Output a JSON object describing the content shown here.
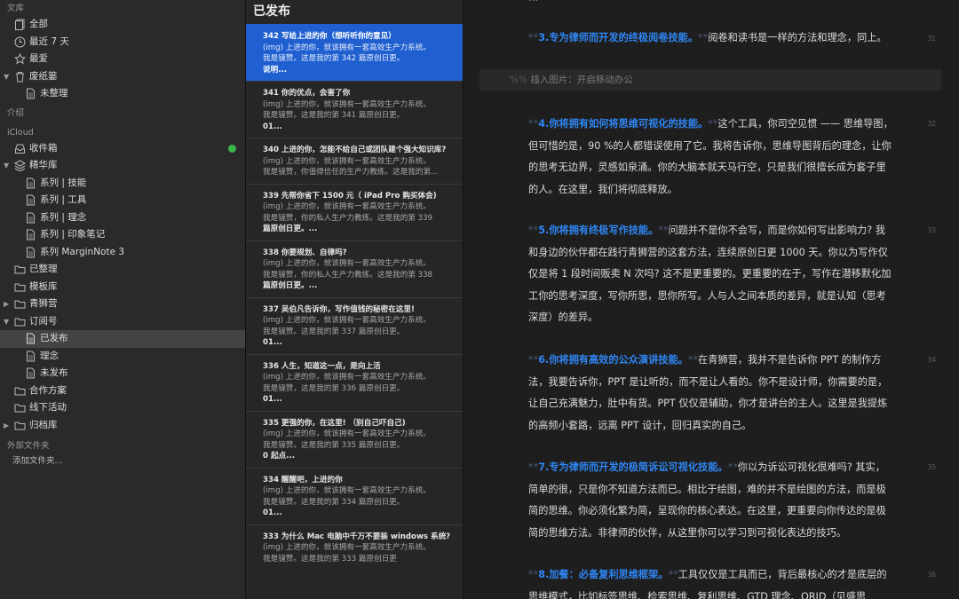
{
  "sidebar": {
    "library_header": "文库",
    "library": [
      {
        "label": "全部",
        "icon": "document-stack-icon"
      },
      {
        "label": "最近 7 天",
        "icon": "clock-icon"
      },
      {
        "label": "最爱",
        "icon": "star-icon"
      },
      {
        "label": "废纸篓",
        "icon": "trash-icon"
      },
      {
        "label": "未整理",
        "icon": "document-icon"
      }
    ],
    "intro_header": "介绍",
    "icloud_header": "iCloud",
    "icloud": [
      {
        "label": "收件箱",
        "icon": "inbox-icon"
      },
      {
        "label": "精华库",
        "icon": "stack-icon"
      },
      {
        "label": "系列 | 技能",
        "icon": "document-icon"
      },
      {
        "label": "系列 | 工具",
        "icon": "document-icon"
      },
      {
        "label": "系列 | 理念",
        "icon": "document-icon"
      },
      {
        "label": "系列 | 印象笔记",
        "icon": "document-icon"
      },
      {
        "label": "系列 MarginNote 3",
        "icon": "document-icon"
      },
      {
        "label": "已整理",
        "icon": "folder-icon"
      },
      {
        "label": "模板库",
        "icon": "folder-icon"
      },
      {
        "label": "青狮营",
        "icon": "folder-icon"
      },
      {
        "label": "订阅号",
        "icon": "folder-icon"
      },
      {
        "label": "已发布",
        "icon": "document-icon"
      },
      {
        "label": "理念",
        "icon": "document-icon"
      },
      {
        "label": "未发布",
        "icon": "document-icon"
      },
      {
        "label": "合作方案",
        "icon": "folder-icon"
      },
      {
        "label": "线下活动",
        "icon": "folder-icon"
      },
      {
        "label": "归档库",
        "icon": "folder-icon"
      }
    ],
    "external_header": "外部文件夹",
    "add_folder": "添加文件夹..."
  },
  "list": {
    "title": "已发布",
    "items": [
      {
        "title": "342 写给上进的你（想听听你的意见）",
        "l1": "(img) 上进的你，就该拥有一套高效生产力系统。",
        "l2": "我是镜赞。这是我的第 342 篇原创日更。",
        "l3": "说明..."
      },
      {
        "title": "341 你的优点，会害了你",
        "l1": "(img) 上进的你，就该拥有一套高效生产力系统。",
        "l2": "我是镜赞。这是我的第 341 篇原创日更。",
        "l3": "01..."
      },
      {
        "title": "340 上进的你，怎能不给自己或团队建个强大知识库?",
        "l1": "(img) 上进的你，就该拥有一套高效生产力系统。",
        "l2": "我是镜赞，你值得信任的生产力教练。这是我的第...",
        "l3": ""
      },
      {
        "title": "339 先帮你省下 1500 元（ iPad Pro 购买体会)",
        "l1": "(img) 上进的你，就该拥有一套高效生产力系统。",
        "l2": "我是镜赞，你的私人生产力教练。这是我的第 339",
        "l3": "篇原创日更。..."
      },
      {
        "title": "338 你要规划、自律吗?",
        "l1": "(img) 上进的你，就该拥有一套高效生产力系统。",
        "l2": "我是镜赞，你的私人生产力教练。这是我的第 338",
        "l3": "篇原创日更。..."
      },
      {
        "title": "337 吴伯凡告诉你，写作值钱的秘密在这里!",
        "l1": "(img) 上进的你，就该拥有一套高效生产力系统。",
        "l2": "我是镜赞。这是我的第 337 篇原创日更。",
        "l3": "01..."
      },
      {
        "title": "336 人生，知道这一点，是向上活",
        "l1": "(img) 上进的你，就该拥有一套高效生产力系统。",
        "l2": "我是镜赞，这是我的第 336 篇原创日更。",
        "l3": "01..."
      },
      {
        "title": "335 更强的你，在这里! （别自己吓自己)",
        "l1": "(img) 上进的你，就该拥有一套高效生产力系统。",
        "l2": "我是镜赞。这是我的第 335 篇原创日更。",
        "l3": "0 起点..."
      },
      {
        "title": "334 醒醒吧，上进的你",
        "l1": "(img) 上进的你，就该拥有一套高效生产力系统。",
        "l2": "我是镜赞。这是我的第 334 篇原创日更。",
        "l3": "01..."
      },
      {
        "title": "333 为什么 Mac 电脑中千万不要装 windows 系统?",
        "l1": "(img) 上进的你，就该拥有一套高效生产力系统。",
        "l2": "我是镜赞。这是我的第 333 篇原创日更",
        "l3": ""
      }
    ]
  },
  "editor": {
    "p1": {
      "num": "31",
      "head": "3.专为律师而开发的终极阅卷技能。",
      "body": "阅卷和读书是一样的方法和理念，同上。"
    },
    "image_row": {
      "prefix": "%%",
      "text": "插入图片：开启移动办公"
    },
    "p2": {
      "num": "32",
      "head": "4.你将拥有如何将思维可视化的技能。",
      "body": "这个工具，你司空见惯 —— 思维导图，但可惜的是，90 %的人都错误使用了它。我将告诉你，思维导图背后的理念，让你的思考无边界，灵感如泉涌。你的大脑本就天马行空，只是我们很擅长成为套子里的人。在这里，我们将彻底释放。"
    },
    "p3": {
      "num": "33",
      "head": "5.你将拥有终极写作技能。",
      "body": "问题并不是你不会写，而是你如何写出影响力? 我和身边的伙伴都在践行青狮营的这套方法，连续原创日更 1000 天。你以为写作仅仅是将 1 段时间贩卖 N 次吗? 这不是更重要的。更重要的在于，写作在潜移默化加工你的思考深度，写你所思，思你所写。人与人之间本质的差异，就是认知（思考深度）的差异。"
    },
    "p4": {
      "num": "34",
      "head": "6.你将拥有高效的公众演讲技能。",
      "body": "在青狮营，我并不是告诉你 PPT 的制作方法，我要告诉你，PPT 是让听的，而不是让人看的。你不是设计师，你需要的是，让自己充满魅力，肚中有货。PPT 仅仅是辅助，你才是讲台的主人。这里是我提炼的高频小套路，远离 PPT 设计，回归真实的自己。"
    },
    "p5": {
      "num": "35",
      "head": "7.专为律师而开发的极简诉讼可视化技能。",
      "body": "你以为诉讼可视化很难吗? 其实，简单的很，只是你不知道方法而已。相比于绘图，难的并不是绘图的方法，而是极简的思维。你必须化繁为简，呈现你的核心表达。在这里，更重要向你传达的是极简的思维方法。非律师的伙伴，从这里你可以学习到可视化表达的技巧。"
    },
    "p6": {
      "num": "36",
      "head": "8.加餐：必备复利思维框架。",
      "body": "工具仅仅是工具而已，背后最核心的才是底层的思维模式，比如标签思维、检索思维、复利思维、GTD 理念、ORID（见盛思"
    },
    "marker": "**"
  }
}
